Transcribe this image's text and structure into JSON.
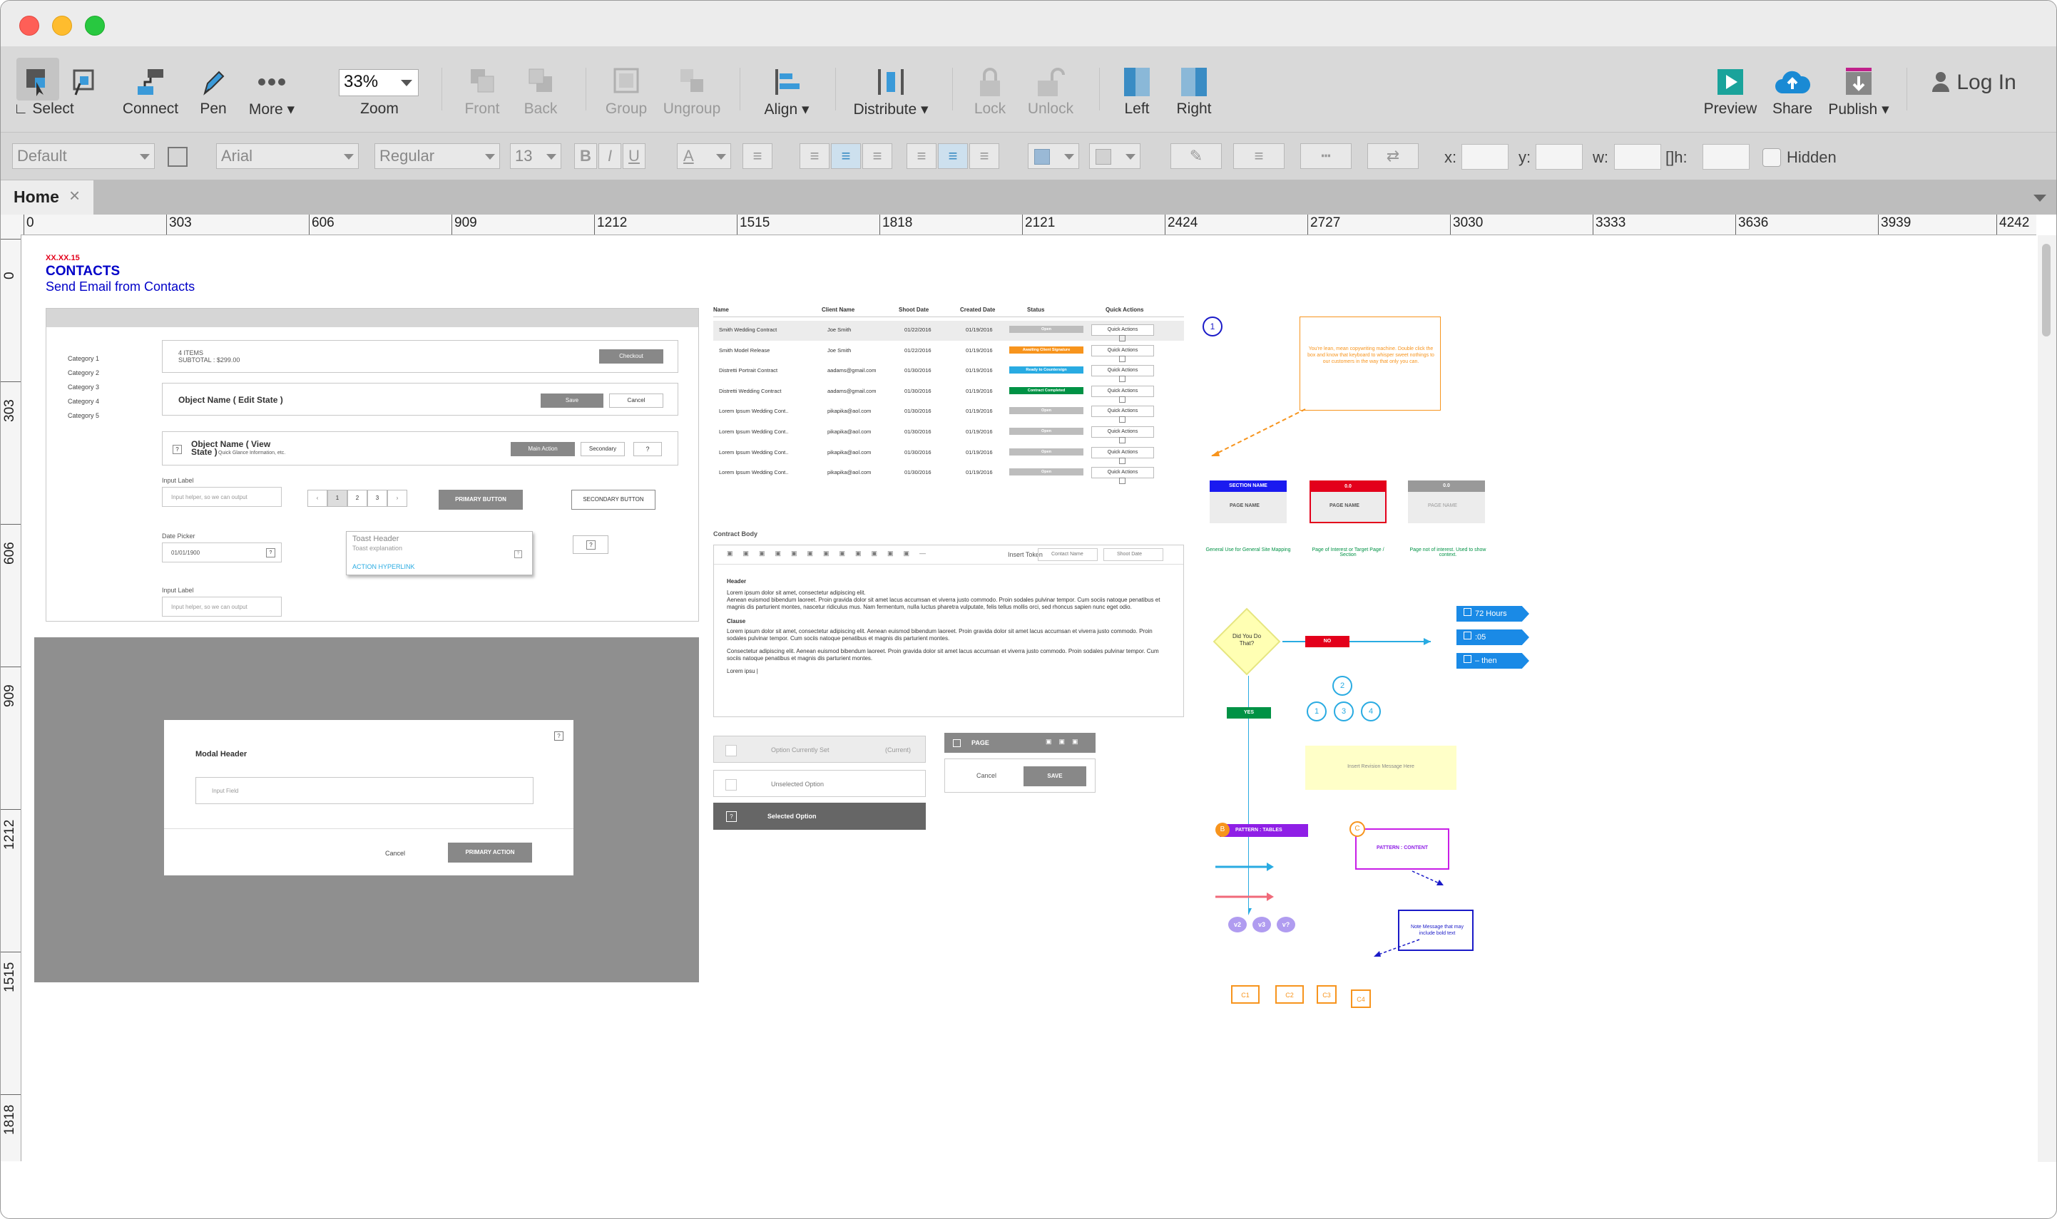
{
  "toolbar": {
    "select": "Select",
    "connect": "Connect",
    "pen": "Pen",
    "more": "More ▾",
    "zoom_value": "33%",
    "zoom": "Zoom",
    "front": "Front",
    "back": "Back",
    "group": "Group",
    "ungroup": "Ungroup",
    "align": "Align ▾",
    "distribute": "Distribute ▾",
    "lock": "Lock",
    "unlock": "Unlock",
    "left": "Left",
    "right": "Right",
    "preview": "Preview",
    "share": "Share",
    "publish": "Publish ▾",
    "login": "Log In"
  },
  "format": {
    "style": "Default",
    "font": "Arial",
    "weight": "Regular",
    "size": "13",
    "bold": "B",
    "italic": "I",
    "underline": "U",
    "font_color": "A",
    "x_label": "x:",
    "y_label": "y:",
    "w_label": "w:",
    "h_label": "h:",
    "hidden": "Hidden"
  },
  "tabs": {
    "home": "Home",
    "close": "×"
  },
  "ruler": {
    "h": [
      "0",
      "303",
      "606",
      "909",
      "1212",
      "1515",
      "1818",
      "2121",
      "2424",
      "2727",
      "3030",
      "3333",
      "3636",
      "3939",
      "4242"
    ],
    "v": [
      "0",
      "303",
      "606",
      "909",
      "1212",
      "1515",
      "1818"
    ]
  },
  "wire": {
    "date": "XX.XX.15",
    "title": "CONTACTS",
    "subtitle": "Send Email from Contacts",
    "categories": [
      "Category 1",
      "Category 2",
      "Category 3",
      "Category 4",
      "Category 5"
    ],
    "items": "4 ITEMS",
    "subtotal": "SUBTOTAL : $299.00",
    "checkout": "Checkout",
    "edit_state": "Object Name ( Edit State )",
    "save": "Save",
    "cancel": "Cancel",
    "view_state": "Object Name ( View State )",
    "view_sub": "Quick Glance Information, etc.",
    "main_action": "Main Action",
    "secondary": "Secondary",
    "input_label": "Input Label",
    "input_helper": "Input helper, so we can output",
    "pages": [
      "1",
      "2",
      "3"
    ],
    "primary_button": "PRIMARY BUTTON",
    "secondary_button": "SECONDARY BUTTON",
    "date_picker": "Date Picker",
    "date_value": "01/01/1900",
    "toast_header": "Toast Header",
    "toast_expl": "Toast explanation",
    "action_link": "ACTION HYPERLINK",
    "input_label2": "Input Label",
    "input_helper2": "Input helper, so we can output",
    "modal_header": "Modal Header",
    "input_field": "Input Field",
    "modal_cancel": "Cancel",
    "primary_action": "PRIMARY ACTION"
  },
  "table": {
    "headers": [
      "Name",
      "Client Name",
      "Shoot Date",
      "Created Date",
      "Status",
      "Quick Actions"
    ],
    "rows": [
      {
        "name": "Smith Wedding Contract",
        "client": "Joe Smith",
        "shoot": "01/22/2016",
        "created": "01/19/2016",
        "status": "Open",
        "color": "#bdbdbd",
        "qa": "Quick Actions"
      },
      {
        "name": "Smith Model Release",
        "client": "Joe Smith",
        "shoot": "01/22/2016",
        "created": "01/19/2016",
        "status": "Awaiting Client Signature",
        "color": "#f7941d",
        "qa": "Quick Actions"
      },
      {
        "name": "Distretti Portrait Contract",
        "client": "aadams@gmail.com",
        "shoot": "01/30/2016",
        "created": "01/19/2016",
        "status": "Ready to Countersign",
        "color": "#29abe2",
        "qa": "Quick Actions"
      },
      {
        "name": "Distretti Wedding Contract",
        "client": "aadams@gmail.com",
        "shoot": "01/30/2016",
        "created": "01/19/2016",
        "status": "Contract Completed",
        "color": "#009245",
        "qa": "Quick Actions"
      },
      {
        "name": "Lorem Ipsum Wedding Cont..",
        "client": "pikapika@aol.com",
        "shoot": "01/30/2016",
        "created": "01/19/2016",
        "status": "Open",
        "color": "#bdbdbd",
        "qa": "Quick Actions"
      },
      {
        "name": "Lorem Ipsum Wedding Cont..",
        "client": "pikapika@aol.com",
        "shoot": "01/30/2016",
        "created": "01/19/2016",
        "status": "Open",
        "color": "#bdbdbd",
        "qa": "Quick Actions"
      },
      {
        "name": "Lorem Ipsum Wedding Cont..",
        "client": "pikapika@aol.com",
        "shoot": "01/30/2016",
        "created": "01/19/2016",
        "status": "Open",
        "color": "#bdbdbd",
        "qa": "Quick Actions"
      },
      {
        "name": "Lorem Ipsum Wedding Cont..",
        "client": "pikapika@aol.com",
        "shoot": "01/30/2016",
        "created": "01/19/2016",
        "status": "Open",
        "color": "#bdbdbd",
        "qa": "Quick Actions"
      }
    ]
  },
  "contract": {
    "label": "Contract Body",
    "insert_token": "Insert Token",
    "contact_name": "Contact Name",
    "shoot_date": "Shoot Date",
    "header": "Header",
    "p1": "Lorem ipsum dolor sit amet, consectetur adipiscing elit.",
    "p2": "Aenean euismod bibendum laoreet. Proin gravida dolor sit amet lacus accumsan et viverra justo commodo. Proin sodales pulvinar tempor. Cum sociis natoque penatibus et magnis dis parturient montes, nascetur ridiculus mus. Nam fermentum, nulla luctus pharetra vulputate, felis tellus mollis orci, sed rhoncus sapien nunc eget odio.",
    "clause": "Clause",
    "p3": "Lorem ipsum dolor sit amet, consectetur adipiscing elit. Aenean euismod bibendum laoreet. Proin gravida dolor sit amet lacus accumsan et viverra justo commodo. Proin sodales pulvinar tempor. Cum sociis natoque penatibus et magnis dis parturient montes.",
    "p4": "Consectetur adipiscing elit. Aenean euismod bibendum laoreet. Proin gravida dolor sit amet lacus accumsan et viverra justo commodo. Proin sodales pulvinar tempor. Cum sociis natoque penatibus et magnis dis parturient montes.",
    "p5": "Lorem ipsu |"
  },
  "options": {
    "current": "Option Currently Set",
    "current_tag": "(Current)",
    "unselected": "Unselected Option",
    "selected": "Selected Option",
    "page": "PAGE",
    "cancel": "Cancel",
    "save": "SAVE"
  },
  "legend": {
    "note": "You're lean, mean copywriting machine. Double click the box and know that keyboard to whisper sweet nothings to our customers in the way that only you can.",
    "section_name": "SECTION NAME",
    "page_name": "PAGE NAME",
    "red_num": "0.0",
    "grey_num": "0.0",
    "general_use": "General Use for General Site Mapping",
    "page_interest": "Page of Interest or Target Page / Section",
    "page_not": "Page not of interest. Used to show context.",
    "decision": "Did You Do That?",
    "no": "NO",
    "yes": "YES",
    "hours": "72 Hours",
    "five": ":05",
    "then": "– then",
    "insert_rev": "Insert Revision Message Here",
    "pattern_tables": "PATTERN : TABLES",
    "pattern_content": "PATTERN : CONTENT",
    "note_bold": "Note Message that may include bold text",
    "v_tags": [
      "v2",
      "v3",
      "v?"
    ],
    "c_tags": [
      "C1",
      "C2",
      "C3",
      "C4"
    ],
    "circles": [
      "1",
      "2",
      "3",
      "4"
    ]
  }
}
